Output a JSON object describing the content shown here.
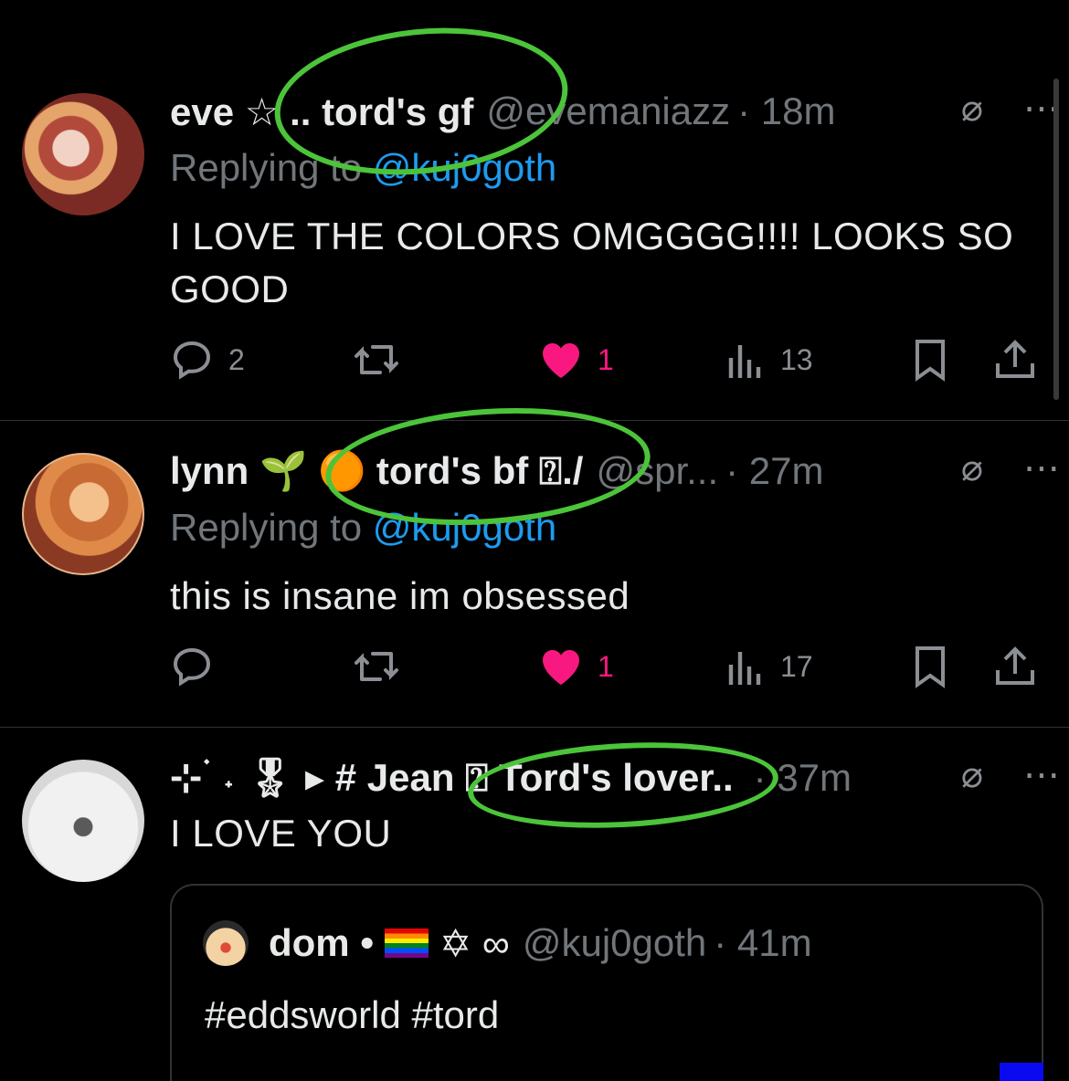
{
  "posts": [
    {
      "display_name": "eve ☆ .. tord's gf",
      "handle": "@evemaniazz",
      "time": "· 18m",
      "replying_prefix": "Replying to ",
      "replying_mention": "@kuj0goth",
      "text": "I LOVE THE COLORS OMGGGG!!!! LOOKS SO GOOD",
      "replies": "2",
      "likes": "1",
      "views": "13"
    },
    {
      "display_name": "lynn 🌱 🟠 tord's bf ⍰./",
      "handle": "@spr...",
      "time": "· 27m",
      "replying_prefix": "Replying to ",
      "replying_mention": "@kuj0goth",
      "text": "this is insane im obsessed",
      "replies": "",
      "likes": "1",
      "views": "17"
    },
    {
      "display_name": "⊹ ࣪ ˖ 🎖 ▸ # Jean ⍰ Tord's lover..",
      "handle": "",
      "time": "· 37m",
      "text": "I LOVE YOU"
    }
  ],
  "quoted": {
    "display_name": "dom •",
    "name_suffix": "✡ ∞",
    "handle": "@kuj0goth",
    "time": "· 41m",
    "text": "#eddsworld #tord"
  },
  "icons": {
    "more": "more-icon",
    "grok": "slash-circle-icon",
    "reply": "reply-icon",
    "repost": "repost-icon",
    "like": "heart-icon",
    "views": "views-icon",
    "bookmark": "bookmark-icon",
    "share": "share-icon"
  },
  "colors": {
    "like": "#f91880",
    "mention": "#1d9bf0",
    "annotation": "#4cc43a"
  }
}
